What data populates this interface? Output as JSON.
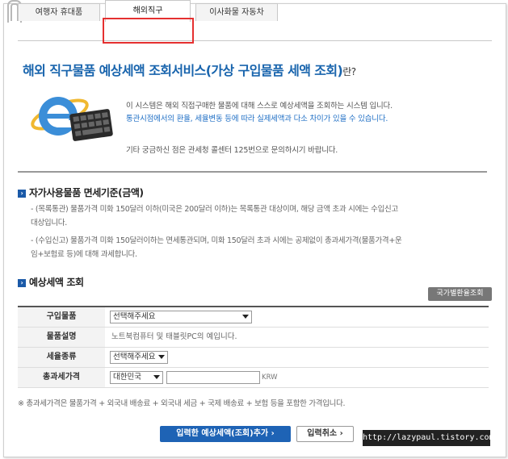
{
  "tabs": [
    {
      "label": "여행자 휴대품"
    },
    {
      "label": "해외직구"
    },
    {
      "label": "이사화물 자동차"
    }
  ],
  "header": {
    "title": "해외 직구물품 예상세액 조회서비스(가상 구입물품 세액 조회)",
    "title_suffix": "란?"
  },
  "intro": {
    "line1": "이 시스템은 해외 직접구매한 물품에 대해 스스로 예상세액을 조회하는 시스템 입니다.",
    "line2": "통관시점에서의 환율, 세율변동 등에 따라 실제세액과 다소 차이가 있을 수 있습니다.",
    "line3": "기타 궁금하신 점은 관세청 콜센터 125번으로 문의하시기 바랍니다."
  },
  "exemption": {
    "heading": "자가사용물품 면세기준(금액)",
    "item1a": "- (목록통관) 물품가격 미화 150달러 이하(미국은 200달러 이하)는 목록통관 대상이며, 해당 금액 초과 시에는 수입신고",
    "item1b": "대상입니다.",
    "item2a": "- (수입신고) 물품가격 미화 150달러이하는 면세통관되며, 미화 150달러 초과 시에는 공제없이 총과세가격(물품가격+운",
    "item2b": "임+보험료 등)에 대해 과세합니다."
  },
  "estimate": {
    "heading": "예상세액 조회",
    "rate_button": "국가별환율조회",
    "rows": {
      "item_label": "구입물품",
      "item_select": "선택해주세요",
      "desc_label": "물품설명",
      "desc_value": "노트북컴퓨터 및 태블릿PC의 예입니다.",
      "tax_label": "세율종류",
      "tax_select": "선택해주세요",
      "price_label": "총과세가격",
      "country_select": "대한민국",
      "price_value": "",
      "unit": "KRW"
    },
    "note": "※ 총과세가격은 물품가격 + 외국내 배송료 + 외국내 세금 + 국제 배송료 + 보험 등을 포함한 가격입니다.",
    "submit_button": "입력한 예상세액(조회)추가 ›",
    "cancel_button": "입력취소 ›"
  },
  "watermark": "http://lazypaul.tistory.com",
  "colors": {
    "accent": "#1864ad",
    "highlight": "#e53030"
  }
}
